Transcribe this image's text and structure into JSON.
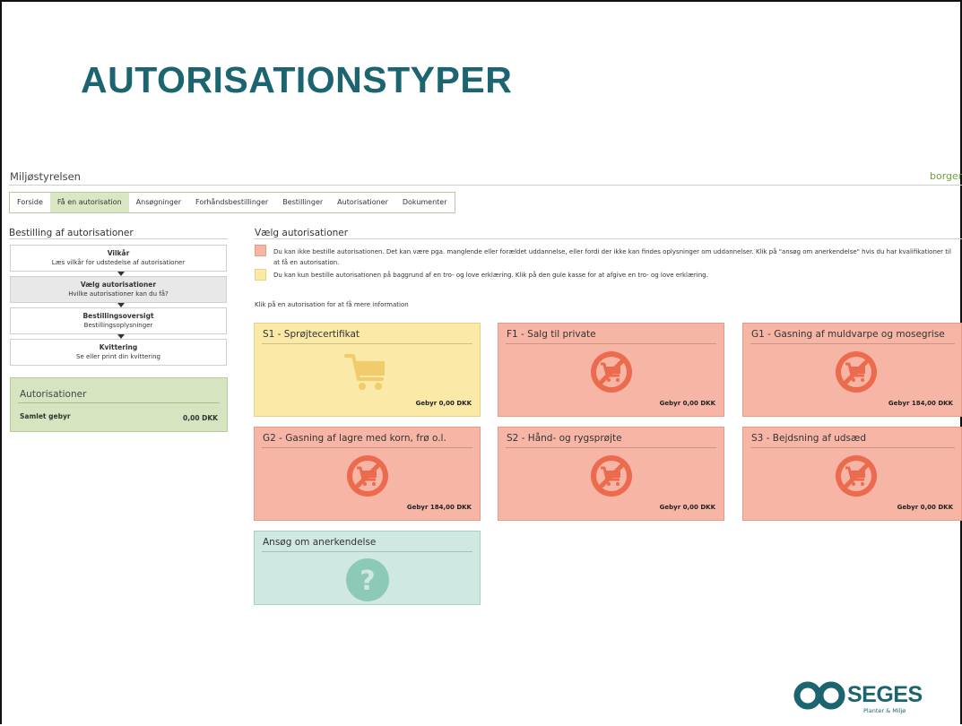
{
  "slide": {
    "title": "AUTORISATIONSTYPER"
  },
  "site": {
    "name": "Miljøstyrelsen",
    "link": "borger.d"
  },
  "nav": {
    "tabs": [
      {
        "label": "Forside"
      },
      {
        "label": "Få en autorisation"
      },
      {
        "label": "Ansøgninger"
      },
      {
        "label": "Forhåndsbestillinger"
      },
      {
        "label": "Bestillinger"
      },
      {
        "label": "Autorisationer"
      },
      {
        "label": "Dokumenter"
      }
    ],
    "active_index": 1
  },
  "sidebar": {
    "title": "Bestilling af autorisationer",
    "steps": [
      {
        "title": "Vilkår",
        "subtitle": "Læs vilkår for udstedelse af autorisationer"
      },
      {
        "title": "Vælg autorisationer",
        "subtitle": "Hvilke autorisationer kan du få?"
      },
      {
        "title": "Bestillingsoversigt",
        "subtitle": "Bestillingsoplysninger"
      },
      {
        "title": "Kvittering",
        "subtitle": "Se eller print din kvittering"
      }
    ],
    "active_step": 1,
    "box": {
      "title": "Autorisationer",
      "label": "Samlet gebyr",
      "value": "0,00 DKK"
    }
  },
  "main": {
    "title": "Vælg autorisationer",
    "legend": [
      {
        "color": "#f7b6a5",
        "text": "Du kan ikke bestille autorisationen. Det kan være pga. manglende eller forældet uddannelse, eller fordi der ikke kan findes oplysninger om uddannelser. Klik på \"ansøg om anerkendelse\" hvis du har kvalifikationer til at få en autorisation."
      },
      {
        "color": "#fbe9a8",
        "text": "Du kan kun bestille autorisationen på baggrund af en tro- og love erklæring. Klik på den gule kasse for at afgive en tro- og love erklæring."
      }
    ],
    "hint": "Klik på en autorisation for at få mere information",
    "tiles": [
      {
        "title": "S1 - Sprøjtecertifikat",
        "fee": "Gebyr 0,00 DKK",
        "status": "yellow",
        "icon": "cart-icon"
      },
      {
        "title": "F1 - Salg til private",
        "fee": "Gebyr 0,00 DKK",
        "status": "red",
        "icon": "no-cart-icon"
      },
      {
        "title": "G1 - Gasning af muldvarpe og mosegrise",
        "fee": "Gebyr 184,00 DKK",
        "status": "red",
        "icon": "no-cart-icon"
      },
      {
        "title": "G2 - Gasning af lagre med korn, frø o.l.",
        "fee": "Gebyr 184,00 DKK",
        "status": "red",
        "icon": "no-cart-icon"
      },
      {
        "title": "S2 - Hånd- og rygsprøjte",
        "fee": "Gebyr 0,00 DKK",
        "status": "red",
        "icon": "no-cart-icon"
      },
      {
        "title": "S3 - Bejdsning af udsæd",
        "fee": "Gebyr 0,00 DKK",
        "status": "red",
        "icon": "no-cart-icon"
      },
      {
        "title": "Ansøg om anerkendelse",
        "fee": "",
        "status": "teal",
        "icon": "question-icon"
      }
    ]
  },
  "logo": {
    "word": "SEGES",
    "sub": "Planter & Miljø"
  }
}
